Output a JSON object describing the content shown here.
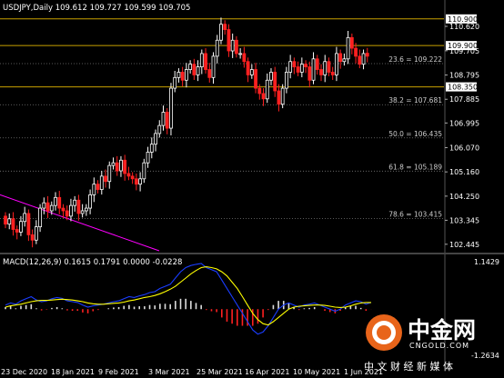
{
  "price_pane": {
    "title": "USDJPY,Daily  109.612 109.727 109.599 109.705",
    "price_axis": [
      "110.620",
      "109.705",
      "108.795",
      "107.885",
      "106.995",
      "106.070",
      "105.160",
      "104.250",
      "103.345",
      "102.445"
    ],
    "highlight_levels": [
      "110.900",
      "109.900",
      "108.350"
    ],
    "fib_labels": [
      "23.6 = 109.222",
      "38.2 = 107.681",
      "50.0 = 106.435",
      "61.8 = 105.189",
      "78.6 = 103.415"
    ]
  },
  "macd_pane": {
    "title": "MACD(12,26,9) 0.1615 0.1791 0.0000 -0.0228",
    "axis_top": "1.1429",
    "axis_bottom": "-1.2634"
  },
  "dates": [
    "23 Dec 2020",
    "18 Jan 2021",
    "9 Feb 2021",
    "3 Mar 2021",
    "25 Mar 2021",
    "16 Apr 2021",
    "10 May 2021",
    "1 Jun 2021"
  ],
  "watermark": {
    "brand": "中金网",
    "domain": "CNGOLD.COM",
    "slogan": "中 文 财 经 新 媒 体"
  },
  "colors": {
    "bull": "#ffffff",
    "bear": "#ff2020",
    "level_line": "#c8a000",
    "trendline": "#ff00ff",
    "macd_line": "#1a3dff",
    "signal_line": "#ffff00"
  },
  "chart_data": [
    {
      "type": "candlestick",
      "title": "USDJPY,Daily  109.612 109.727 109.599 109.705",
      "symbol": "USDJPY",
      "timeframe": "Daily",
      "last_bar": {
        "open": 109.612,
        "high": 109.727,
        "low": 109.599,
        "close": 109.705
      },
      "ylim": [
        102.2,
        111.2
      ],
      "x_tick_labels": [
        "23 Dec 2020",
        "18 Jan 2021",
        "9 Feb 2021",
        "3 Mar 2021",
        "25 Mar 2021",
        "16 Apr 2021",
        "10 May 2021",
        "1 Jun 2021"
      ],
      "y_tick_labels": [
        "110.620",
        "109.705",
        "108.795",
        "107.885",
        "106.995",
        "106.070",
        "105.160",
        "104.250",
        "103.345",
        "102.445"
      ],
      "horizontal_levels": [
        110.9,
        109.9,
        108.35
      ],
      "fibonacci": [
        {
          "level": "23.6",
          "price": 109.222
        },
        {
          "level": "38.2",
          "price": 107.681
        },
        {
          "level": "50.0",
          "price": 106.435
        },
        {
          "level": "61.8",
          "price": 105.189
        },
        {
          "level": "78.6",
          "price": 103.415
        }
      ],
      "closes": [
        103.2,
        103.4,
        103.0,
        102.9,
        103.3,
        103.6,
        102.8,
        102.6,
        103.1,
        103.8,
        104.0,
        103.7,
        103.9,
        104.2,
        103.8,
        103.7,
        103.5,
        103.9,
        104.1,
        103.6,
        103.7,
        103.8,
        104.3,
        104.7,
        104.5,
        105.0,
        104.8,
        105.4,
        105.5,
        105.2,
        105.6,
        105.1,
        105.0,
        104.9,
        104.7,
        104.9,
        105.5,
        105.9,
        106.2,
        106.6,
        106.9,
        107.4,
        106.8,
        108.3,
        108.7,
        108.9,
        108.6,
        109.0,
        109.2,
        108.8,
        109.1,
        109.6,
        109.0,
        108.7,
        109.5,
        110.1,
        110.7,
        110.5,
        109.7,
        110.1,
        109.6,
        109.6,
        109.3,
        108.8,
        109.0,
        108.3,
        108.1,
        107.9,
        108.6,
        108.9,
        108.2,
        107.7,
        108.3,
        108.9,
        109.3,
        109.1,
        108.9,
        109.2,
        109.1,
        108.6,
        109.4,
        109.0,
        108.8,
        109.3,
        108.9,
        108.8,
        109.6,
        109.3,
        109.4,
        110.2,
        109.8,
        109.5,
        109.2,
        109.6,
        109.5,
        109.7
      ],
      "opens": [
        103.5,
        103.2,
        103.4,
        103.0,
        102.9,
        103.3,
        103.6,
        102.8,
        102.6,
        103.1,
        103.8,
        104.0,
        103.7,
        103.9,
        104.2,
        103.8,
        103.7,
        103.5,
        103.9,
        104.1,
        103.6,
        103.7,
        103.8,
        104.3,
        104.7,
        104.5,
        105.0,
        104.8,
        105.4,
        105.5,
        105.2,
        105.6,
        105.1,
        105.0,
        104.9,
        104.7,
        104.9,
        105.5,
        105.9,
        106.2,
        106.6,
        106.9,
        107.4,
        106.8,
        108.3,
        108.7,
        108.9,
        108.6,
        109.0,
        109.2,
        108.8,
        109.1,
        109.6,
        109.0,
        108.7,
        109.5,
        110.1,
        110.7,
        110.5,
        109.7,
        110.1,
        109.6,
        109.6,
        109.3,
        108.8,
        109.0,
        108.3,
        108.1,
        107.9,
        108.6,
        108.9,
        108.2,
        107.7,
        108.3,
        108.9,
        109.3,
        109.1,
        108.9,
        109.2,
        109.1,
        108.6,
        109.4,
        109.0,
        108.8,
        109.3,
        108.9,
        108.8,
        109.6,
        109.3,
        109.4,
        110.2,
        109.8,
        109.5,
        109.2,
        109.612
      ]
    },
    {
      "type": "bar",
      "title": "MACD(12,26,9) 0.1615 0.1791 0.0000 -0.0228",
      "series": [
        {
          "name": "MACD(12,26,9)",
          "values": [
            0.1,
            0.15,
            0.12,
            0.2,
            0.25,
            0.3,
            0.22,
            0.18,
            0.2,
            0.25,
            0.28,
            0.26,
            0.2,
            0.18,
            0.16,
            0.1,
            0.05,
            0.08,
            0.1,
            0.12,
            0.15,
            0.18,
            0.2,
            0.25,
            0.3,
            0.28,
            0.32,
            0.35,
            0.4,
            0.42,
            0.5,
            0.55,
            0.6,
            0.75,
            0.9,
            1.0,
            1.05,
            1.08,
            1.1,
            1.0,
            0.95,
            0.9,
            0.7,
            0.5,
            0.3,
            0.1,
            -0.1,
            -0.3,
            -0.5,
            -0.6,
            -0.55,
            -0.4,
            -0.2,
            0.0,
            0.1,
            0.15,
            0.1,
            0.05,
            0.1,
            0.12,
            0.15,
            0.1,
            0.05,
            0.0,
            -0.05,
            0.0,
            0.1,
            0.15,
            0.2,
            0.18,
            0.12,
            0.16
          ]
        },
        {
          "name": "Signal",
          "values": [
            0.05,
            0.08,
            0.1,
            0.12,
            0.15,
            0.18,
            0.2,
            0.21,
            0.21,
            0.22,
            0.23,
            0.24,
            0.23,
            0.22,
            0.2,
            0.18,
            0.15,
            0.13,
            0.12,
            0.12,
            0.13,
            0.14,
            0.15,
            0.17,
            0.2,
            0.22,
            0.25,
            0.28,
            0.3,
            0.33,
            0.37,
            0.42,
            0.48,
            0.55,
            0.65,
            0.75,
            0.85,
            0.93,
            1.0,
            1.02,
            1.0,
            0.97,
            0.9,
            0.8,
            0.65,
            0.5,
            0.3,
            0.1,
            -0.1,
            -0.25,
            -0.35,
            -0.38,
            -0.3,
            -0.2,
            -0.1,
            0.0,
            0.05,
            0.07,
            0.08,
            0.09,
            0.1,
            0.1,
            0.09,
            0.07,
            0.05,
            0.04,
            0.05,
            0.08,
            0.12,
            0.15,
            0.16,
            0.1615
          ]
        }
      ],
      "y_tick_labels": [
        "1.1429",
        "-1.2634"
      ]
    }
  ]
}
